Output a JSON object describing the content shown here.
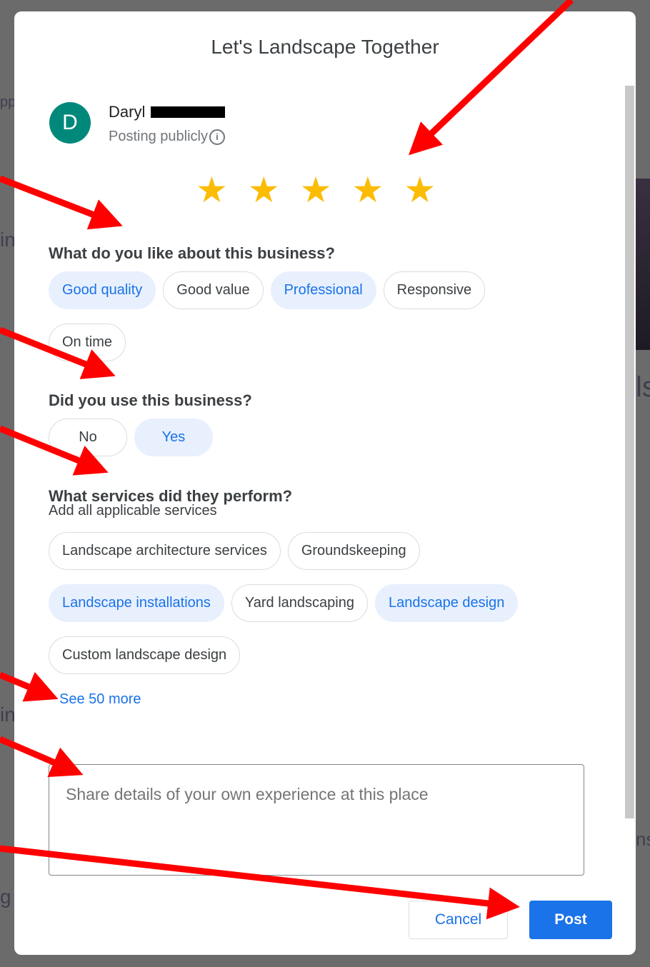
{
  "dialog": {
    "title": "Let's Landscape Together",
    "user": {
      "initial": "D",
      "name": "Daryl",
      "visibility": "Posting publicly"
    },
    "rating": {
      "value": 5,
      "max": 5,
      "color": "#fbbc04"
    },
    "q1": {
      "label": "What do you like about this business?",
      "chips": [
        {
          "label": "Good quality",
          "selected": true
        },
        {
          "label": "Good value",
          "selected": false
        },
        {
          "label": "Professional",
          "selected": true
        },
        {
          "label": "Responsive",
          "selected": false
        },
        {
          "label": "On time",
          "selected": false
        }
      ]
    },
    "q2": {
      "label": "Did you use this business?",
      "chips": [
        {
          "label": "No",
          "selected": false
        },
        {
          "label": "Yes",
          "selected": true
        }
      ]
    },
    "q3": {
      "label": "What services did they perform?",
      "sub": "Add all applicable services",
      "chips": [
        {
          "label": "Landscape architecture services",
          "selected": false
        },
        {
          "label": "Groundskeeping",
          "selected": false
        },
        {
          "label": "Landscape installations",
          "selected": true
        },
        {
          "label": "Yard landscaping",
          "selected": false
        },
        {
          "label": "Landscape design",
          "selected": true
        },
        {
          "label": "Custom landscape design",
          "selected": false
        }
      ]
    },
    "see_more": "See 50 more",
    "review_placeholder": "Share details of your own experience at this place",
    "cancel": "Cancel",
    "post": "Post"
  },
  "colors": {
    "accent": "#1a73e8",
    "selected_chip_bg": "#e8f0fe",
    "avatar": "#00897b",
    "annotation": "#ff0000"
  }
}
